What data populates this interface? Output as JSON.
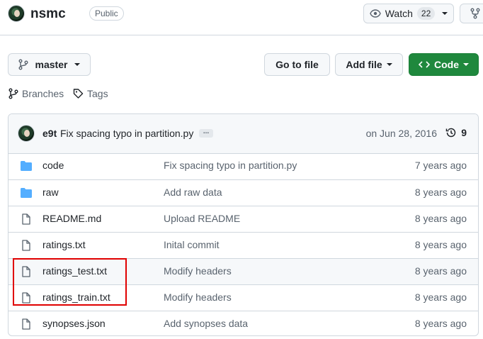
{
  "header": {
    "repo_name": "nsmc",
    "visibility": "Public",
    "watch_label": "Watch",
    "watch_count": "22"
  },
  "toolbar": {
    "branch": "master",
    "go_to_file": "Go to file",
    "add_file": "Add file",
    "code": "Code",
    "branches": "Branches",
    "tags": "Tags"
  },
  "commit": {
    "author": "e9t",
    "message": "Fix spacing typo in partition.py",
    "ellipsis": "...",
    "date": "on Jun 28, 2016",
    "count": "9"
  },
  "files": [
    {
      "name": "code",
      "type": "folder",
      "message": "Fix spacing typo in partition.py",
      "age": "7 years ago"
    },
    {
      "name": "raw",
      "type": "folder",
      "message": "Add raw data",
      "age": "8 years ago"
    },
    {
      "name": "README.md",
      "type": "file",
      "message": "Upload README",
      "age": "8 years ago"
    },
    {
      "name": "ratings.txt",
      "type": "file",
      "message": "Inital commit",
      "age": "8 years ago"
    },
    {
      "name": "ratings_test.txt",
      "type": "file",
      "message": "Modify headers",
      "age": "8 years ago"
    },
    {
      "name": "ratings_train.txt",
      "type": "file",
      "message": "Modify headers",
      "age": "8 years ago"
    },
    {
      "name": "synopses.json",
      "type": "file",
      "message": "Add synopses data",
      "age": "8 years ago"
    }
  ],
  "colors": {
    "accent_green": "#1f883d",
    "folder_blue": "#54aeff",
    "highlight_red": "#e00000"
  }
}
